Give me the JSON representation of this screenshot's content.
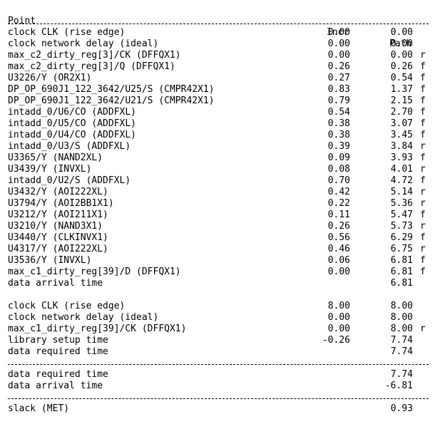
{
  "header": {
    "point": "Point",
    "incr": "Incr",
    "path": "Path"
  },
  "arrival_rows": [
    {
      "point": "clock CLK (rise edge)",
      "incr": "0.00",
      "path": "0.00",
      "edge": ""
    },
    {
      "point": "clock network delay (ideal)",
      "incr": "0.00",
      "path": "0.00",
      "edge": ""
    },
    {
      "point": "max_c2_dirty_reg[3]/CK (DFFQX1)",
      "incr": "0.00",
      "path": "0.00",
      "edge": "r"
    },
    {
      "point": "max_c2_dirty_reg[3]/Q (DFFQX1)",
      "incr": "0.26",
      "path": "0.26",
      "edge": "f"
    },
    {
      "point": "U3226/Y (OR2X1)",
      "incr": "0.27",
      "path": "0.54",
      "edge": "f"
    },
    {
      "point": "DP_OP_690J1_122_3642/U25/S (CMPR42X1)",
      "incr": "0.83",
      "path": "1.37",
      "edge": "f"
    },
    {
      "point": "DP_OP_690J1_122_3642/U21/S (CMPR42X1)",
      "incr": "0.79",
      "path": "2.15",
      "edge": "f"
    },
    {
      "point": "intadd_0/U6/CO (ADDFXL)",
      "incr": "0.54",
      "path": "2.70",
      "edge": "f"
    },
    {
      "point": "intadd_0/U5/CO (ADDFXL)",
      "incr": "0.38",
      "path": "3.07",
      "edge": "f"
    },
    {
      "point": "intadd_0/U4/CO (ADDFXL)",
      "incr": "0.38",
      "path": "3.45",
      "edge": "f"
    },
    {
      "point": "intadd_0/U3/S (ADDFXL)",
      "incr": "0.39",
      "path": "3.84",
      "edge": "r"
    },
    {
      "point": "U3365/Y (NAND2XL)",
      "incr": "0.09",
      "path": "3.93",
      "edge": "f"
    },
    {
      "point": "U3439/Y (INVXL)",
      "incr": "0.08",
      "path": "4.01",
      "edge": "r"
    },
    {
      "point": "intadd_0/U2/S (ADDFXL)",
      "incr": "0.70",
      "path": "4.72",
      "edge": "f"
    },
    {
      "point": "U3432/Y (AOI222XL)",
      "incr": "0.42",
      "path": "5.14",
      "edge": "r"
    },
    {
      "point": "U3794/Y (AOI2BB1X1)",
      "incr": "0.22",
      "path": "5.36",
      "edge": "r"
    },
    {
      "point": "U3212/Y (AOI211X1)",
      "incr": "0.11",
      "path": "5.47",
      "edge": "f"
    },
    {
      "point": "U3210/Y (NAND3X1)",
      "incr": "0.26",
      "path": "5.73",
      "edge": "r"
    },
    {
      "point": "U3440/Y (CLKINVX1)",
      "incr": "0.56",
      "path": "6.29",
      "edge": "f"
    },
    {
      "point": "U4317/Y (AOI222XL)",
      "incr": "0.46",
      "path": "6.75",
      "edge": "r"
    },
    {
      "point": "U3536/Y (INVXL)",
      "incr": "0.06",
      "path": "6.81",
      "edge": "f"
    },
    {
      "point": "max_c1_dirty_reg[39]/D (DFFQX1)",
      "incr": "0.00",
      "path": "6.81",
      "edge": "f"
    },
    {
      "point": "data arrival time",
      "incr": "",
      "path": "6.81",
      "edge": ""
    }
  ],
  "required_rows": [
    {
      "point": "clock CLK (rise edge)",
      "incr": "8.00",
      "path": "8.00",
      "edge": ""
    },
    {
      "point": "clock network delay (ideal)",
      "incr": "0.00",
      "path": "8.00",
      "edge": ""
    },
    {
      "point": "max_c1_dirty_reg[39]/CK (DFFQX1)",
      "incr": "0.00",
      "path": "8.00",
      "edge": "r"
    },
    {
      "point": "library setup time",
      "incr": "-0.26",
      "path": "7.74",
      "edge": ""
    },
    {
      "point": "data required time",
      "incr": "",
      "path": "7.74",
      "edge": ""
    }
  ],
  "summary_rows": [
    {
      "point": "data required time",
      "incr": "",
      "path": "7.74",
      "edge": ""
    },
    {
      "point": "data arrival time",
      "incr": "",
      "path": "-6.81",
      "edge": ""
    }
  ],
  "slack_row": {
    "point": "slack (MET)",
    "incr": "",
    "path": "0.93",
    "edge": ""
  }
}
